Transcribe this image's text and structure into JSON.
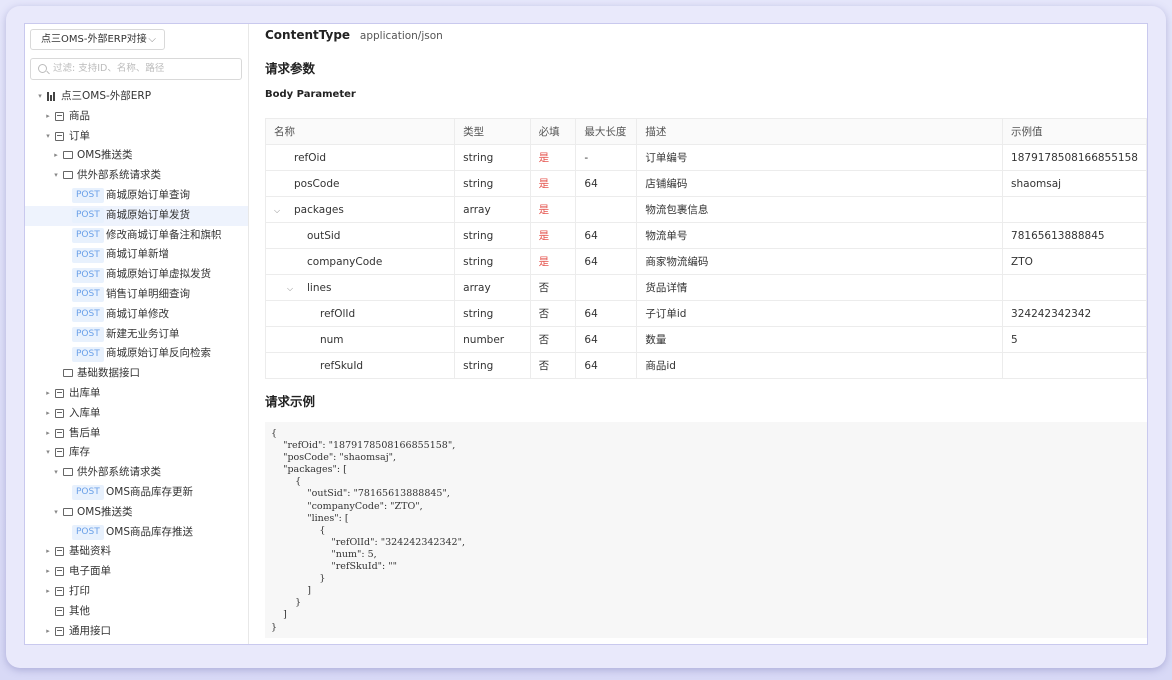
{
  "sidebar": {
    "project_select": "点三OMS-外部ERP对接",
    "filter_placeholder": "过滤: 支持ID、名称、路径",
    "tree": [
      {
        "depth": 0,
        "arrow": "▾",
        "icon": "bars",
        "label": "点三OMS-外部ERP"
      },
      {
        "depth": 1,
        "arrow": "▸",
        "icon": "box",
        "label": "商品"
      },
      {
        "depth": 1,
        "arrow": "▾",
        "icon": "box",
        "label": "订单"
      },
      {
        "depth": 2,
        "arrow": "▸",
        "icon": "folder",
        "label": "OMS推送类"
      },
      {
        "depth": 2,
        "arrow": "▾",
        "icon": "folder",
        "label": "供外部系统请求类"
      },
      {
        "depth": 3,
        "method": "POST",
        "label": "商城原始订单查询"
      },
      {
        "depth": 3,
        "method": "POST",
        "label": "商城原始订单发货",
        "selected": true
      },
      {
        "depth": 3,
        "method": "POST",
        "label": "修改商城订单备注和旗帜"
      },
      {
        "depth": 3,
        "method": "POST",
        "label": "商城订单新增"
      },
      {
        "depth": 3,
        "method": "POST",
        "label": "商城原始订单虚拟发货"
      },
      {
        "depth": 3,
        "method": "POST",
        "label": "销售订单明细查询"
      },
      {
        "depth": 3,
        "method": "POST",
        "label": "商城订单修改"
      },
      {
        "depth": 3,
        "method": "POST",
        "label": "新建无业务订单"
      },
      {
        "depth": 3,
        "method": "POST",
        "label": "商城原始订单反向检索"
      },
      {
        "depth": 2,
        "arrow": "",
        "icon": "folder",
        "label": "基础数据接口"
      },
      {
        "depth": 1,
        "arrow": "▸",
        "icon": "box",
        "label": "出库单"
      },
      {
        "depth": 1,
        "arrow": "▸",
        "icon": "box",
        "label": "入库单"
      },
      {
        "depth": 1,
        "arrow": "▸",
        "icon": "box",
        "label": "售后单"
      },
      {
        "depth": 1,
        "arrow": "▾",
        "icon": "box",
        "label": "库存"
      },
      {
        "depth": 2,
        "arrow": "▾",
        "icon": "folder",
        "label": "供外部系统请求类"
      },
      {
        "depth": 3,
        "method": "POST",
        "label": "OMS商品库存更新"
      },
      {
        "depth": 2,
        "arrow": "▾",
        "icon": "folder",
        "label": "OMS推送类"
      },
      {
        "depth": 3,
        "method": "POST",
        "label": "OMS商品库存推送"
      },
      {
        "depth": 1,
        "arrow": "▸",
        "icon": "box",
        "label": "基础资料"
      },
      {
        "depth": 1,
        "arrow": "▸",
        "icon": "box",
        "label": "电子面单"
      },
      {
        "depth": 1,
        "arrow": "▸",
        "icon": "box",
        "label": "打印"
      },
      {
        "depth": 1,
        "arrow": "",
        "icon": "box",
        "label": "其他"
      },
      {
        "depth": 1,
        "arrow": "▸",
        "icon": "box",
        "label": "通用接口"
      }
    ]
  },
  "main": {
    "content_type_key": "ContentType",
    "content_type_value": "application/json",
    "request_params_title": "请求参数",
    "body_param_title": "Body Parameter",
    "table_headers": [
      "名称",
      "类型",
      "必填",
      "最大长度",
      "描述",
      "示例值"
    ],
    "rows": [
      {
        "level": 0,
        "expander": "",
        "name": "refOid",
        "type": "string",
        "required": "是",
        "max": "-",
        "desc": "订单编号",
        "example": "1879178508166855158"
      },
      {
        "level": 0,
        "expander": "",
        "name": "posCode",
        "type": "string",
        "required": "是",
        "max": "64",
        "desc": "店铺编码",
        "example": "shaomsaj"
      },
      {
        "level": 0,
        "expander": "⌵",
        "name": "packages",
        "type": "array",
        "required": "是",
        "max": "",
        "desc": "物流包裹信息",
        "example": ""
      },
      {
        "level": 1,
        "expander": "",
        "name": "outSid",
        "type": "string",
        "required": "是",
        "max": "64",
        "desc": "物流单号",
        "example": "78165613888845"
      },
      {
        "level": 1,
        "expander": "",
        "name": "companyCode",
        "type": "string",
        "required": "是",
        "max": "64",
        "desc": "商家物流编码",
        "example": "ZTO"
      },
      {
        "level": 1,
        "expander": "⌵",
        "name": "lines",
        "type": "array",
        "required": "否",
        "max": "",
        "desc": "货品详情",
        "example": ""
      },
      {
        "level": 2,
        "expander": "",
        "name": "refOlId",
        "type": "string",
        "required": "否",
        "max": "64",
        "desc": "子订单id",
        "example": "324242342342"
      },
      {
        "level": 2,
        "expander": "",
        "name": "num",
        "type": "number",
        "required": "否",
        "max": "64",
        "desc": "数量",
        "example": "5"
      },
      {
        "level": 2,
        "expander": "",
        "name": "refSkuId",
        "type": "string",
        "required": "否",
        "max": "64",
        "desc": "商品id",
        "example": ""
      }
    ],
    "request_example_title": "请求示例",
    "request_example": "{\n    \"refOid\": \"1879178508166855158\",\n    \"posCode\": \"shaomsaj\",\n    \"packages\": [\n        {\n            \"outSid\": \"78165613888845\",\n            \"companyCode\": \"ZTO\",\n            \"lines\": [\n                {\n                    \"refOlId\": \"324242342342\",\n                    \"num\": 5,\n                    \"refSkuId\": \"\"\n                }\n            ]\n        }\n    ]\n}"
  },
  "colors": {
    "required_yes": "#e5554f",
    "post_badge_bg": "#e8f1fd",
    "post_badge_text": "#6aa0e8",
    "selected_row": "#eef3fd"
  }
}
